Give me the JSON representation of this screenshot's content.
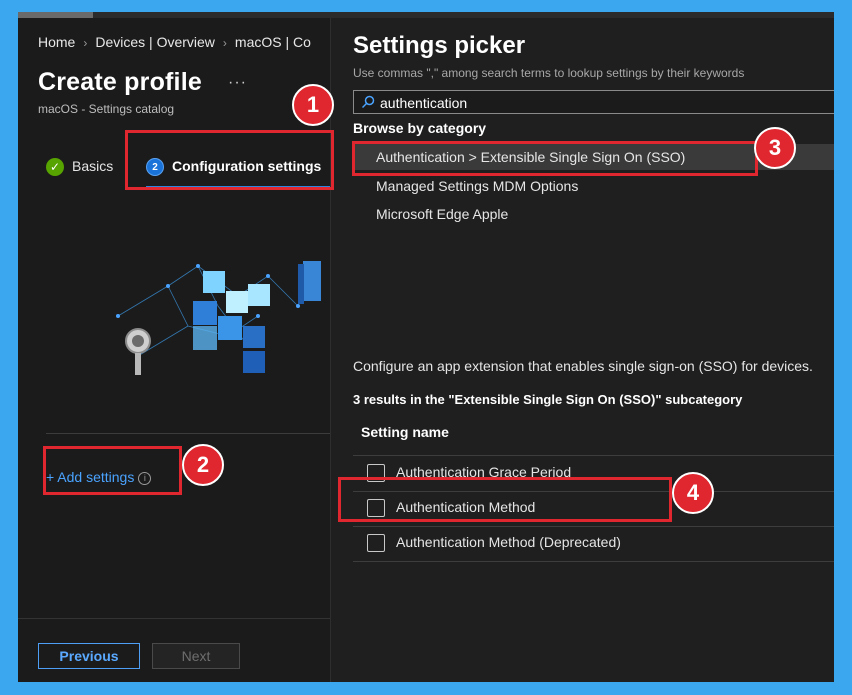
{
  "breadcrumb": {
    "items": [
      "Home",
      "Devices | Overview",
      "macOS | Co"
    ]
  },
  "profile": {
    "title": "Create profile",
    "more": "···",
    "subtitle": "macOS - Settings catalog"
  },
  "steps": {
    "basics": "Basics",
    "basics_icon": "✓",
    "config": "Configuration settings",
    "config_number": "2"
  },
  "add_settings": {
    "label": "+ Add settings",
    "info_icon": "i"
  },
  "footer": {
    "previous": "Previous",
    "next": "Next"
  },
  "picker": {
    "title": "Settings picker",
    "hint": "Use commas \",\" among search terms to lookup settings by their keywords",
    "search_value": "authentication",
    "browse_label": "Browse by category",
    "categories": [
      "Authentication > Extensible Single Sign On (SSO)",
      "Managed Settings MDM Options",
      "Microsoft Edge Apple"
    ],
    "description": "Configure an app extension that enables single sign-on (SSO) for devices.",
    "results_text": "3 results in the \"Extensible Single Sign On (SSO)\" subcategory",
    "column_header": "Setting name",
    "settings": [
      "Authentication Grace Period",
      "Authentication Method",
      "Authentication Method (Deprecated)"
    ]
  },
  "annotations": {
    "markers": [
      "1",
      "2",
      "3",
      "4"
    ],
    "color": "#e0262e"
  },
  "colors": {
    "accent_blue": "#2f86e0",
    "link_blue": "#4aa3ff",
    "frame_border": "#3aa7ef",
    "success_green": "#57a300"
  }
}
